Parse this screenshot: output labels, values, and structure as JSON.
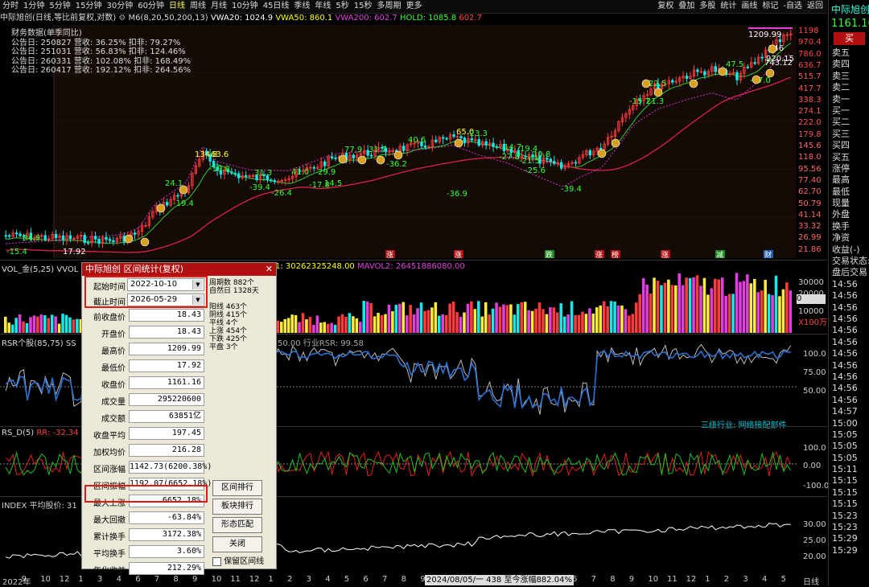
{
  "toolbar": {
    "periods": [
      "分时",
      "1分钟",
      "5分钟",
      "15分钟",
      "30分钟",
      "60分钟",
      "日线",
      "周线",
      "月线",
      "10分钟",
      "45日线",
      "季线",
      "年线",
      "5秒",
      "15秒",
      "多周期",
      "更多"
    ],
    "active_period": "日线",
    "actions": [
      "复权",
      "叠加",
      "多股",
      "统计",
      "画线",
      "标记",
      "-自选",
      "返回"
    ]
  },
  "info": {
    "stock": "中际旭创(日线,等比前复权,对数)",
    "ma": "M6(8,20,50,200,13)",
    "vwa20": "VWA20: 1024.9",
    "vwa50": "VWA50: 860.1",
    "vwa200": "VWA200: 602.7",
    "hold": "HOLD: 1085.8",
    "extra": "602.7",
    "fin_title": "财务数据(单季同比)",
    "fin_rows": [
      "公告日: 250827  营收: 36.25%  扣非: 79.27%",
      "公告日: 251031  营收: 56.83%  扣非: 124.46%",
      "公告日: 260331  营收: 102.08%  扣非: 168.49%",
      "公告日: 260417  营收: 192.12%  扣非: 264.56%"
    ]
  },
  "price_axis": [
    "1198",
    "970.4",
    "786.0",
    "636.7",
    "515.7",
    "417.7",
    "338.3",
    "274.1",
    "222.0",
    "179.8",
    "145.6",
    "118.0",
    "95.56",
    "77.40",
    "62.70",
    "50.79",
    "41.14",
    "33.32",
    "26.99",
    "21.86"
  ],
  "chart_labels": [
    {
      "t": "-15.4",
      "c": "#3f3"
    },
    {
      "t": "34.9",
      "c": "#3f3"
    },
    {
      "t": "17.92",
      "c": "#fff"
    },
    {
      "t": "-19.4",
      "c": "#3f3"
    },
    {
      "t": "24.1",
      "c": "#3f3"
    },
    {
      "t": "134.8",
      "c": "#ff3"
    },
    {
      "t": "63.6",
      "c": "#ff3"
    },
    {
      "t": "-19.8",
      "c": "#3f3"
    },
    {
      "t": "-39.4",
      "c": "#3f3"
    },
    {
      "t": "31.3",
      "c": "#3f3"
    },
    {
      "t": "-26.4",
      "c": "#3f3"
    },
    {
      "t": "41.0",
      "c": "#3f3"
    },
    {
      "t": "-17.8",
      "c": "#3f3"
    },
    {
      "t": "14.5",
      "c": "#3f3"
    },
    {
      "t": "29.9",
      "c": "#3f3"
    },
    {
      "t": "77.9",
      "c": "#3f3"
    },
    {
      "t": "31.7",
      "c": "#3f3"
    },
    {
      "t": "-36.2",
      "c": "#3f3"
    },
    {
      "t": "40.6",
      "c": "#3f3"
    },
    {
      "t": "-36.9",
      "c": "#3f3"
    },
    {
      "t": "65.0",
      "c": "#ff3"
    },
    {
      "t": "-23.3",
      "c": "#3f3"
    },
    {
      "t": "14.7",
      "c": "#3f3"
    },
    {
      "t": "19.4",
      "c": "#3f3"
    },
    {
      "t": "-27.8",
      "c": "#3f3"
    },
    {
      "t": "-21.5",
      "c": "#3f3"
    },
    {
      "t": "-25.6",
      "c": "#3f3"
    },
    {
      "t": "10.8",
      "c": "#3f3"
    },
    {
      "t": "-39.4",
      "c": "#3f3"
    },
    {
      "t": "22.5",
      "c": "#3f3"
    },
    {
      "t": "-15.7",
      "c": "#3f3"
    },
    {
      "t": "21.3",
      "c": "#3f3"
    },
    {
      "t": "47.5",
      "c": "#3f3"
    },
    {
      "t": "-27.0",
      "c": "#3f3"
    },
    {
      "t": "1209.99",
      "c": "#fff"
    },
    {
      "t": "946",
      "c": "#fff"
    },
    {
      "t": "920.15",
      "c": "#fff"
    },
    {
      "t": "743.12",
      "c": "#fff"
    }
  ],
  "event_tags": [
    "涨",
    "涨",
    "跌",
    "涨",
    "榜",
    "涨",
    "减",
    "财"
  ],
  "vol": {
    "label": "VOL_金(5,25)  VVOL",
    "mavol": "1: 30262325248.00",
    "mavol2": "MAVOL2: 26451886080.00",
    "axis": [
      "30000",
      "20000",
      "10000",
      "X100万"
    ],
    "cur": "0"
  },
  "rsr": {
    "label": "RSR个股(85,75)  SS",
    "mid": "50.00  行业RSR: 99.58",
    "axis": [
      "100.0",
      "75.00",
      "50.00"
    ],
    "industry": "三级行业: 网络接配部件"
  },
  "rsd": {
    "label": "RS_D(5)",
    "rr": "RR: -32.34",
    "axis": [
      "100.0",
      "0.00",
      "-100.0"
    ]
  },
  "index": {
    "label": "INDEX  平均股价: 31",
    "axis": [
      "30.00",
      "25.00",
      "20.00"
    ]
  },
  "dialog": {
    "title": "中际旭创 区间统计(复权)",
    "start_label": "起始时间",
    "start": "2022-10-10",
    "end_label": "截止时间",
    "end": "2026-05-29",
    "period_info": [
      "周期数  882个",
      "自然日  1328天"
    ],
    "count_info": [
      "阳线  463个",
      "阴线  415个",
      "平线  4个",
      "上涨  454个",
      "下跌  425个",
      "平盘  3个"
    ],
    "rows": [
      {
        "k": "前收盘价",
        "v": "18.43"
      },
      {
        "k": "开盘价",
        "v": "18.43"
      },
      {
        "k": "最高价",
        "v": "1209.99"
      },
      {
        "k": "最低价",
        "v": "17.92"
      },
      {
        "k": "收盘价",
        "v": "1161.16"
      },
      {
        "k": "成交量",
        "v": "295220600"
      },
      {
        "k": "成交额",
        "v": "63851亿"
      },
      {
        "k": "收盘平均",
        "v": "197.45"
      },
      {
        "k": "加权均价",
        "v": "216.28"
      },
      {
        "k": "区间涨幅",
        "v": "1142.73(6200.38%)"
      },
      {
        "k": "区间振幅",
        "v": "1192.07(6652.18%)"
      },
      {
        "k": "最大上涨",
        "v": "6652.18%"
      },
      {
        "k": "最大回撤",
        "v": "-63.84%"
      },
      {
        "k": "累计换手",
        "v": "3172.38%"
      },
      {
        "k": "平均换手",
        "v": "3.60%"
      },
      {
        "k": "年化收益",
        "v": "212.29%"
      }
    ],
    "buttons": [
      "区间排行",
      "板块排行",
      "形态匹配",
      "关闭"
    ],
    "checkbox": "保留区间线"
  },
  "quote": {
    "name": "中际旭创",
    "price": "1161.16",
    "buy": "买",
    "rows": [
      "卖五",
      "卖四",
      "卖三",
      "卖二",
      "卖一",
      "买一",
      "买二",
      "买三",
      "买四",
      "买五",
      "涨停",
      "最高",
      "最低",
      "现量",
      "外盘",
      "换手",
      "净资",
      "收益(-)",
      "交易状态:",
      "盘后交易",
      "14:56",
      "14:56",
      "14:56",
      "14:56",
      "14:56",
      "14:56",
      "14:56",
      "14:56",
      "14:56",
      "14:56",
      "14:56",
      "14:57",
      "15:00",
      "15:05",
      "15:05",
      "15:05",
      "15:11",
      "15:15",
      "15:15",
      "15:15",
      "15:23",
      "15:23",
      "15:29",
      "15:29"
    ]
  },
  "xaxis": {
    "labels": [
      "2022年",
      "9",
      "10",
      "12",
      "1",
      "3",
      "4",
      "6",
      "7",
      "8",
      "9",
      "10",
      "11",
      "12",
      "1",
      "2",
      "3",
      "4",
      "5",
      "6",
      "7",
      "8",
      "9",
      "10",
      "11",
      "12",
      "1",
      "3",
      "4",
      "5",
      "6",
      "7",
      "8",
      "9",
      "10",
      "11",
      "12",
      "1",
      "2",
      "3",
      "4",
      "5"
    ],
    "status": "2024/08/05/一 438 至今涨幅882.04%",
    "period": "日线"
  },
  "colors": {
    "up": "#ff3b3b",
    "down": "#17e8e8",
    "ma_green": "#2ecc2e",
    "ma_red": "#e0204a",
    "vwa": "#d030d0"
  }
}
